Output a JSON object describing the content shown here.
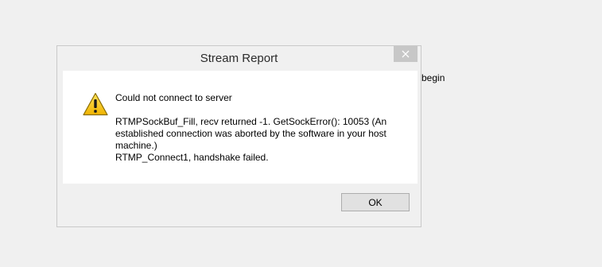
{
  "background": {
    "partial_text": "begin"
  },
  "dialog": {
    "title": "Stream Report",
    "close_icon": "close-icon",
    "warning_icon": "warning-icon",
    "heading": "Could not connect to server",
    "body_lines": [
      "RTMPSockBuf_Fill, recv returned -1. GetSockError(): 10053 (An",
      "established connection was aborted by the software in your host",
      "machine.)",
      "RTMP_Connect1, handshake failed."
    ],
    "ok_label": "OK"
  },
  "colors": {
    "desktop": "#f0f0f0",
    "content_bg": "#ffffff",
    "close_button_bg": "#c7c7c7",
    "warning_yellow": "#f5c400"
  }
}
